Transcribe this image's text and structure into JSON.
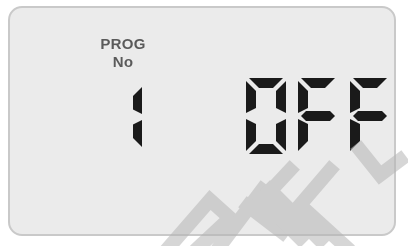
{
  "display": {
    "label_line1": "PROG",
    "label_line2": "No",
    "program_number": "1",
    "status": "0FF"
  },
  "watermark": {
    "text": "ETHEL"
  },
  "colors": {
    "lcd_background": "#ebebeb",
    "lcd_border": "#c9c9c9",
    "segment": "#1a1a1a",
    "label": "#5a5a5a",
    "watermark": "#b5b5b5"
  }
}
